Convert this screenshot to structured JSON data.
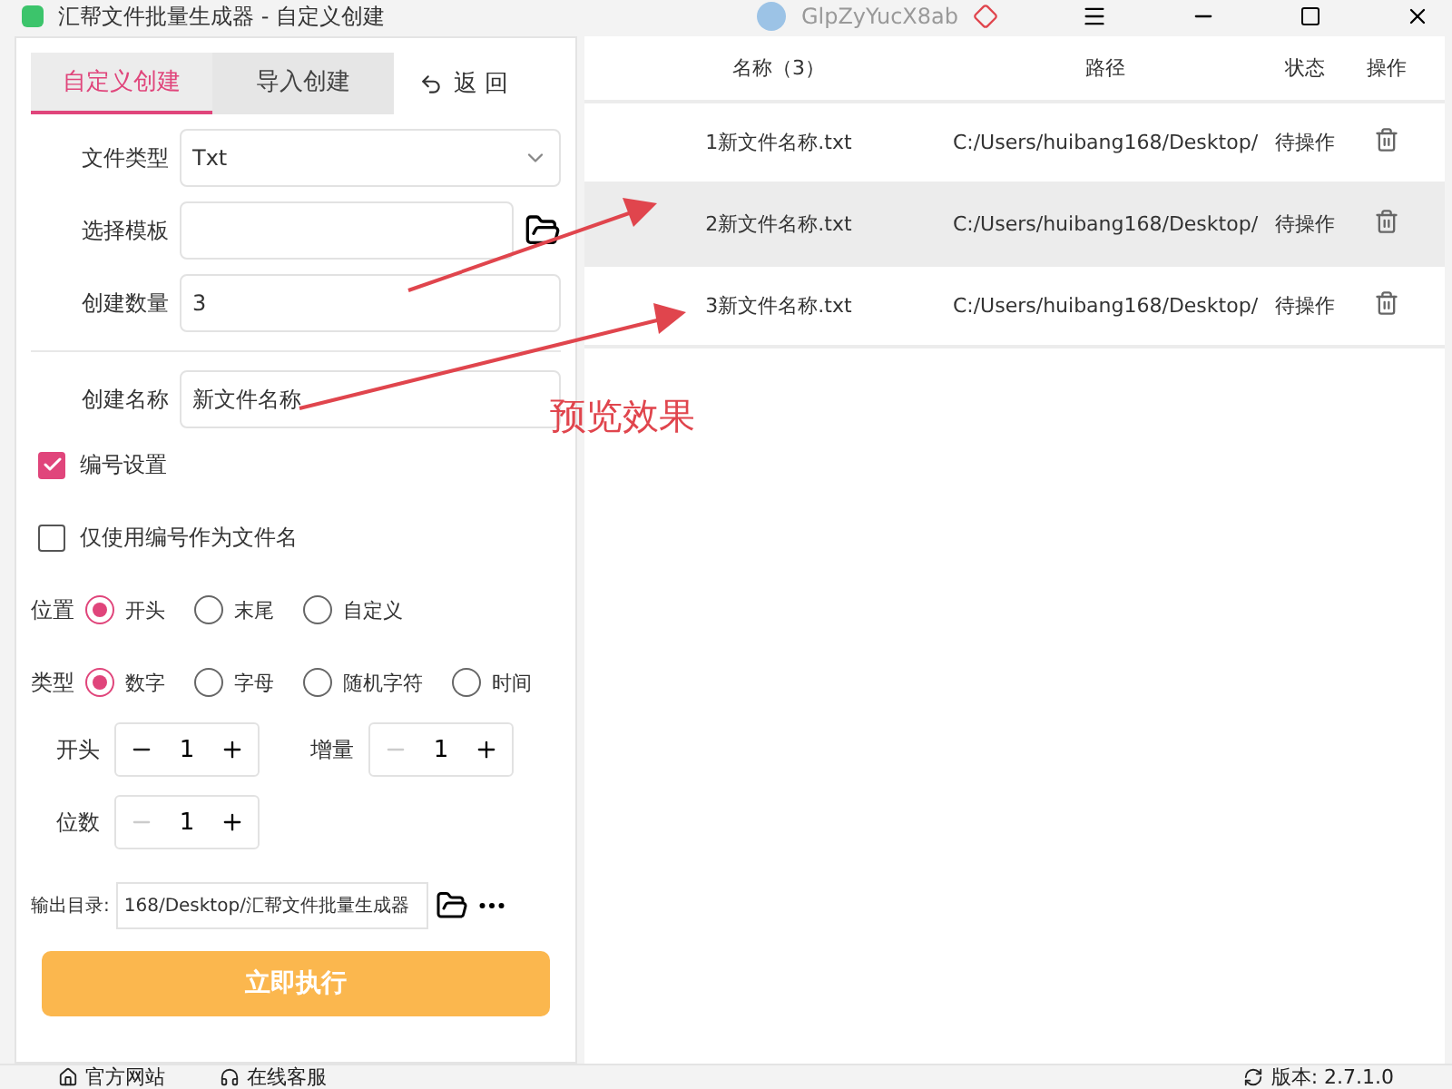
{
  "window": {
    "title": "汇帮文件批量生成器 - 自定义创建",
    "user": "GlpZyYucX8ab"
  },
  "tabs": [
    {
      "label": "自定义创建",
      "selected": true
    },
    {
      "label": "导入创建",
      "selected": false
    }
  ],
  "back_button": {
    "label": "返 回"
  },
  "fields": [
    {
      "kind": "select",
      "label": "文件类型",
      "value": "Txt"
    },
    {
      "kind": "file",
      "label": "选择模板"
    },
    {
      "kind": "text",
      "label": "创建数量",
      "value": "3"
    },
    {
      "kind": "text",
      "label": "创建名称",
      "value": "新文件名称"
    }
  ],
  "checkboxes": [
    {
      "label": "编号设置",
      "checked": true
    },
    {
      "label": "仅使用编号作为文件名",
      "checked": false
    }
  ],
  "radio_groups": [
    {
      "label": "位置",
      "options": [
        {
          "label": "开头",
          "selected": true
        },
        {
          "label": "末尾",
          "selected": false
        },
        {
          "label": "自定义",
          "selected": false
        }
      ]
    },
    {
      "label": "类型",
      "options": [
        {
          "label": "数字",
          "selected": true
        },
        {
          "label": "字母",
          "selected": false
        },
        {
          "label": "随机字符",
          "selected": false
        },
        {
          "label": "时间",
          "selected": false
        }
      ]
    }
  ],
  "steppers": [
    {
      "label": "开头",
      "value": "1",
      "minus_disabled": false
    },
    {
      "label": "增量",
      "value": "1",
      "minus_disabled": true
    },
    {
      "label": "位数",
      "value": "1",
      "minus_disabled": true
    }
  ],
  "output": {
    "label": "输出目录:",
    "value": "168/Desktop/汇帮文件批量生成器"
  },
  "run_button": {
    "label": "立即执行"
  },
  "table": {
    "columns": [
      "名称（3）",
      "路径",
      "状态",
      "操作"
    ],
    "rows": [
      {
        "name": "1新文件名称.txt",
        "path": "C:/Users/huibang168/Desktop/",
        "status": "待操作",
        "selected": false
      },
      {
        "name": "2新文件名称.txt",
        "path": "C:/Users/huibang168/Desktop/",
        "status": "待操作",
        "selected": true
      },
      {
        "name": "3新文件名称.txt",
        "path": "C:/Users/huibang168/Desktop/",
        "status": "待操作",
        "selected": false
      }
    ]
  },
  "annotation": {
    "text": "预览效果"
  },
  "status_bar": {
    "links": [
      "官方网站",
      "在线客服"
    ],
    "version": "版本: 2.7.1.0"
  }
}
